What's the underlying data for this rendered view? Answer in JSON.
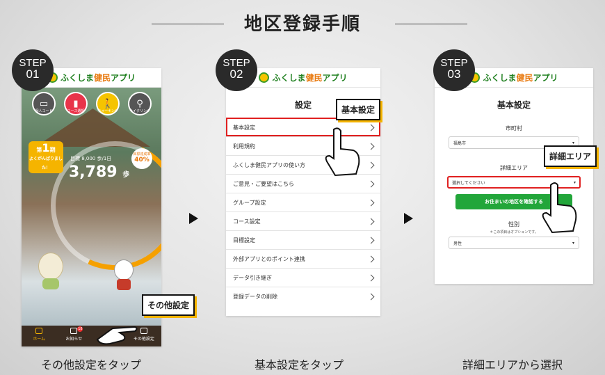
{
  "title": "地区登録手順",
  "arrow_icon": "triangle-right-icon",
  "steps": [
    {
      "label": "STEP",
      "num": "01",
      "caption": "その他設定をタップ"
    },
    {
      "label": "STEP",
      "num": "02",
      "caption": "基本設定をタップ"
    },
    {
      "label": "STEP",
      "num": "03",
      "caption": "詳細エリアから選択"
    }
  ],
  "app_logo": {
    "part1": "ふくしま",
    "part2": "健民",
    "part3": "アプリ"
  },
  "home": {
    "icons": [
      "個人コード",
      "コース選択",
      "ウォーキング",
      "サイクリング"
    ],
    "rank": {
      "label1": "第",
      "num": "1",
      "label2": "期",
      "sub": "よくがんばりました！"
    },
    "goal_text": "目標 8,000 歩/1日",
    "steps_value": "3,789",
    "steps_unit": "歩",
    "achievement": {
      "label": "目標達成率",
      "value": "40%"
    },
    "tabs": [
      "ホーム",
      "お知らせ",
      "",
      "その他設定"
    ],
    "notice_badge": "18",
    "callout": "その他設定"
  },
  "settings": {
    "title": "設定",
    "callout": "基本設定",
    "items": [
      "基本設定",
      "利用規約",
      "ふくしま健民アプリの使い方",
      "ご意見・ご要望はこちら",
      "グループ設定",
      "コース設定",
      "目標設定",
      "外部アプリとのポイント連携",
      "データ引き継ぎ",
      "登録データの削除"
    ]
  },
  "basic": {
    "title": "基本設定",
    "city_label": "市町村",
    "city_value": "福島市",
    "area_label": "詳細エリア",
    "area_value": "選択してください",
    "confirm_button": "お住まいの地区を確認する",
    "gender_label": "性別",
    "gender_note": "＊この項目はオプションです。",
    "gender_value": "男性",
    "callout": "詳細エリア"
  },
  "colors": {
    "accent_green": "#22a63a",
    "highlight_red": "#e02020",
    "callout_shadow": "#f5b400"
  }
}
